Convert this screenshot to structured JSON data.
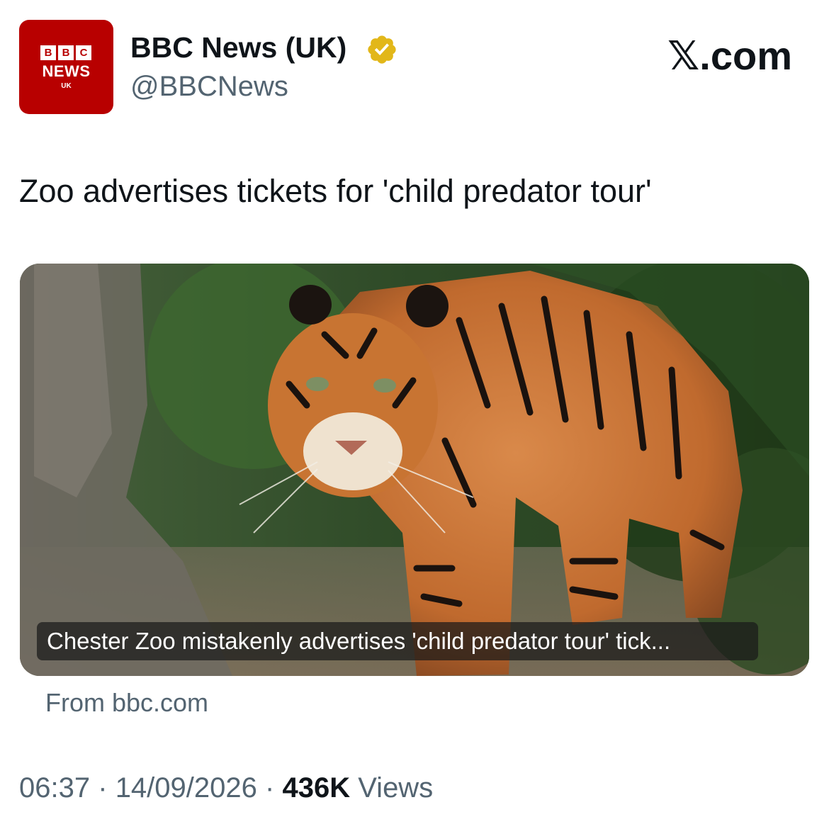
{
  "header": {
    "avatar": {
      "bbc_letters": [
        "B",
        "B",
        "C"
      ],
      "news": "NEWS",
      "region": "UK",
      "color": "#b80000"
    },
    "display_name": "BBC News (UK)",
    "verified_icon": "verified-badge-gold",
    "handle": "@BBCNews",
    "source_mark": "𝕏.com"
  },
  "tweet": {
    "text": "Zoo advertises tickets for 'child predator tour'"
  },
  "card": {
    "image": "tiger-walking-photo",
    "caption": "Chester Zoo mistakenly advertises 'child predator tour' tick...",
    "source": "From bbc.com"
  },
  "meta": {
    "time": "06:37",
    "separator": "·",
    "date": "14/09/2026",
    "views_count": "436K",
    "views_label": "Views"
  }
}
